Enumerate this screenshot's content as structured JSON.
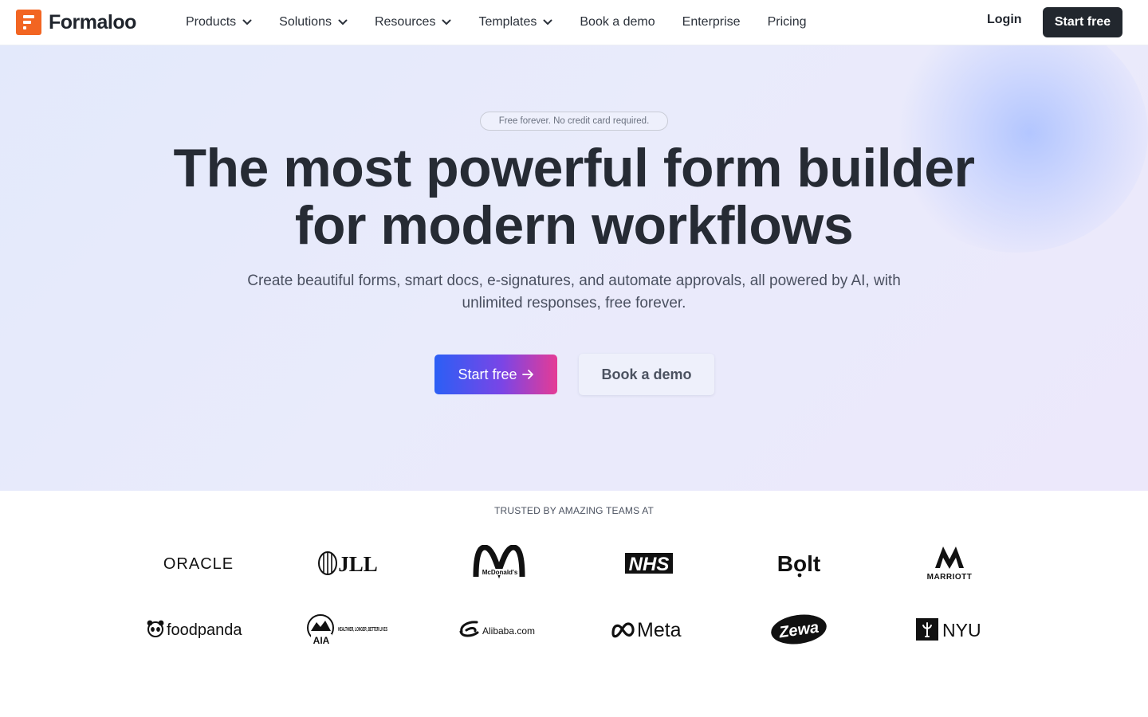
{
  "brand": {
    "name": "Formaloo",
    "color": "#f26522"
  },
  "nav": {
    "items": [
      {
        "label": "Products",
        "dropdown": true
      },
      {
        "label": "Solutions",
        "dropdown": true
      },
      {
        "label": "Resources",
        "dropdown": true
      },
      {
        "label": "Templates",
        "dropdown": true
      },
      {
        "label": "Book a demo",
        "dropdown": false
      },
      {
        "label": "Enterprise",
        "dropdown": false
      },
      {
        "label": "Pricing",
        "dropdown": false
      }
    ],
    "login_label": "Login",
    "start_label": "Start free"
  },
  "hero": {
    "badge": "Free forever. No credit card required.",
    "headline_line1": "The most powerful form builder",
    "headline_line2": "for modern workflows",
    "subtitle": "Create beautiful forms, smart docs, e-signatures, and automate approvals, all powered by AI, with unlimited responses, free forever.",
    "cta_primary": "Start free",
    "cta_secondary": "Book a demo",
    "accent_gradient": [
      "#2b5ff5",
      "#7a45e6",
      "#e53b95"
    ]
  },
  "trusted": {
    "label": "TRUSTED BY AMAZING TEAMS AT",
    "logos": [
      {
        "name": "ORACLE",
        "icon": "oracle-logo"
      },
      {
        "name": "JLL",
        "icon": "jll-logo"
      },
      {
        "name": "McDonald's",
        "icon": "mcdonalds-logo"
      },
      {
        "name": "NHS",
        "icon": "nhs-logo"
      },
      {
        "name": "Bolt",
        "icon": "bolt-logo"
      },
      {
        "name": "MARRIOTT",
        "icon": "marriott-logo"
      },
      {
        "name": "foodpanda",
        "icon": "foodpanda-logo"
      },
      {
        "name": "AIA",
        "tagline": "HEALTHIER, LONGER, BETTER LIVES",
        "icon": "aia-logo"
      },
      {
        "name": "Alibaba.com",
        "icon": "alibaba-logo"
      },
      {
        "name": "Meta",
        "icon": "meta-logo"
      },
      {
        "name": "Zewa",
        "icon": "zewa-logo"
      },
      {
        "name": "NYU",
        "icon": "nyu-logo"
      }
    ]
  }
}
